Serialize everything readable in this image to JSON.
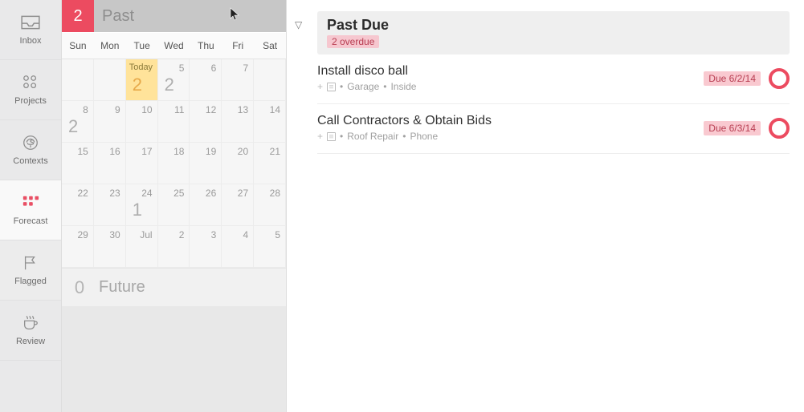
{
  "sidebar": {
    "items": [
      {
        "label": "Inbox",
        "icon": "inbox-icon"
      },
      {
        "label": "Projects",
        "icon": "projects-icon"
      },
      {
        "label": "Contexts",
        "icon": "contexts-icon"
      },
      {
        "label": "Forecast",
        "icon": "forecast-icon"
      },
      {
        "label": "Flagged",
        "icon": "flag-icon"
      },
      {
        "label": "Review",
        "icon": "coffee-icon"
      }
    ]
  },
  "calendar": {
    "past_badge": "2",
    "past_label": "Past",
    "weekdays": [
      "Sun",
      "Mon",
      "Tue",
      "Wed",
      "Thu",
      "Fri",
      "Sat"
    ],
    "today_label": "Today",
    "month_abbrev": "Jul",
    "cells": [
      [
        "",
        "",
        "",
        "5",
        "6",
        "7",
        ""
      ],
      [
        "8",
        "9",
        "10",
        "11",
        "12",
        "13",
        "14"
      ],
      [
        "15",
        "16",
        "17",
        "18",
        "19",
        "20",
        "21"
      ],
      [
        "22",
        "23",
        "24",
        "25",
        "26",
        "27",
        "28"
      ],
      [
        "29",
        "30",
        "",
        "2",
        "3",
        "4",
        "5"
      ]
    ],
    "counts": {
      "r0c2": "2",
      "r0c3": "2",
      "r1c0": "2",
      "r3c2": "1"
    },
    "future_count": "0",
    "future_label": "Future"
  },
  "section": {
    "title": "Past Due",
    "overdue_text": "2 overdue"
  },
  "tasks": [
    {
      "title": "Install disco ball",
      "project": "Garage",
      "context": "Inside",
      "due": "Due 6/2/14"
    },
    {
      "title": "Call Contractors & Obtain Bids",
      "project": "Roof Repair",
      "context": "Phone",
      "due": "Due 6/3/14"
    }
  ],
  "meta_dot": "•"
}
